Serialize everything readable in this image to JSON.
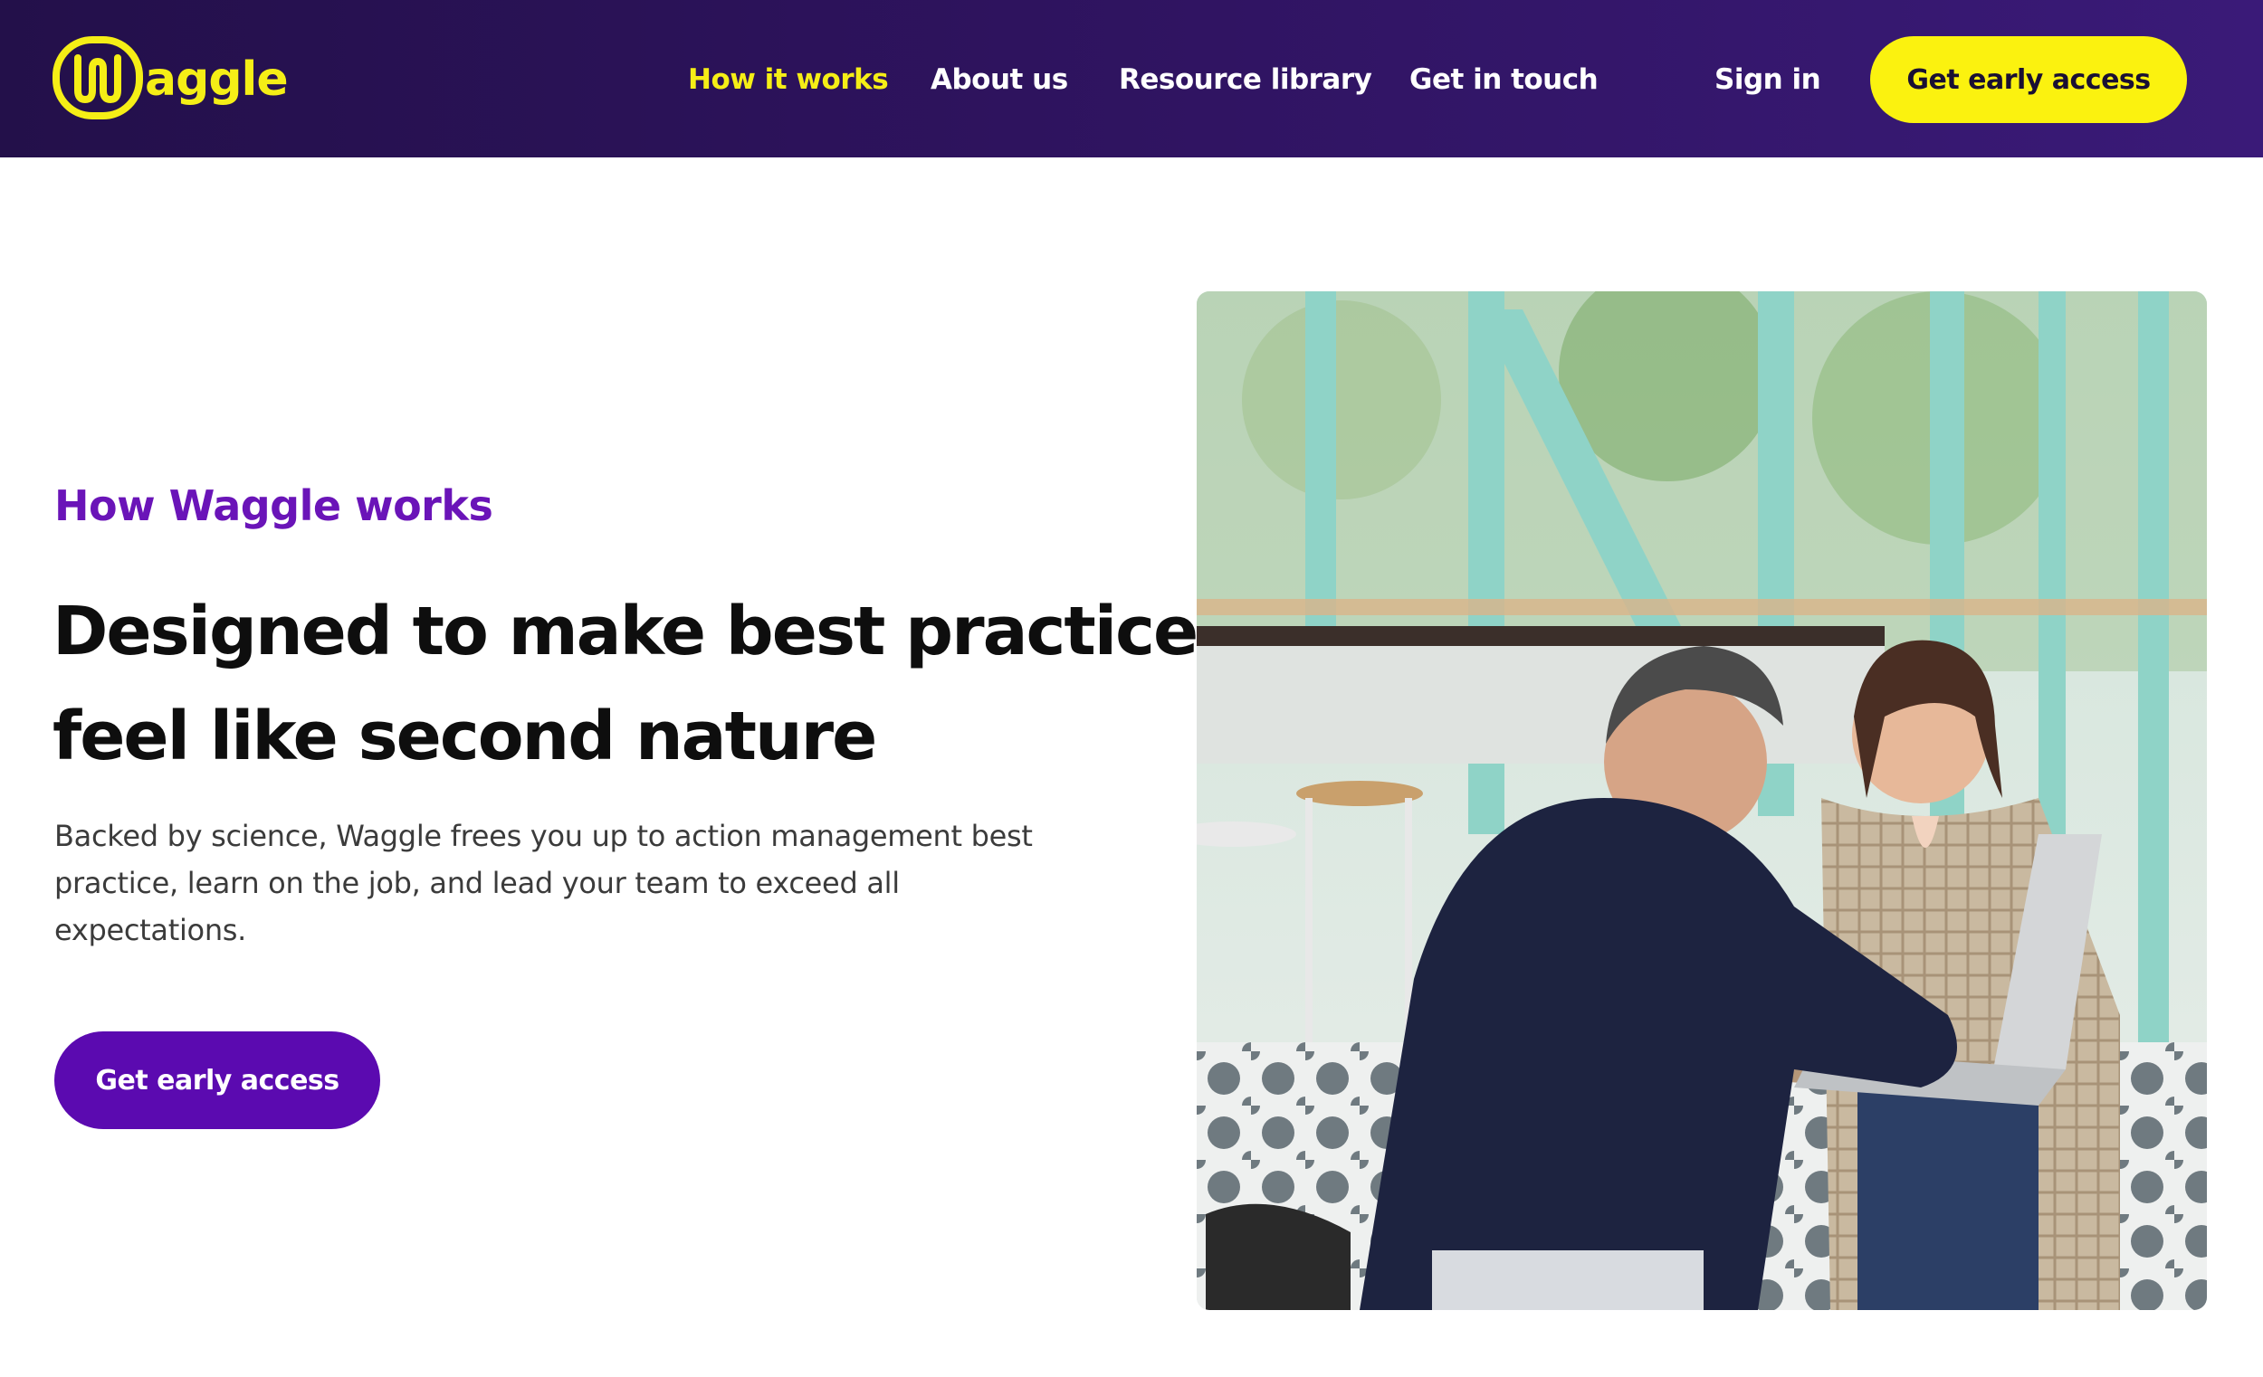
{
  "brand": {
    "name": "Waggle",
    "logo_letter": "W",
    "logo_rest": "aggle",
    "colors": {
      "header_bg": "#2e135e",
      "accent_yellow": "#f5ee16",
      "accent_purple": "#5b0ab0",
      "eyebrow_purple": "#6a14b8"
    }
  },
  "header": {
    "nav": [
      {
        "label": "How it works",
        "active": true
      },
      {
        "label": "About us",
        "active": false
      },
      {
        "label": "Resource library",
        "active": false
      },
      {
        "label": "Get in touch",
        "active": false
      }
    ],
    "sign_in_label": "Sign in",
    "cta_label": "Get early access"
  },
  "hero": {
    "eyebrow": "How Waggle works",
    "headline_line1": "Designed to make best practice",
    "headline_line2": "feel like second nature",
    "description": "Backed by science, Waggle frees you up to action management best practice, learn on the job, and lead your team to exceed all expectations.",
    "cta_label": "Get early access",
    "image_icon": "photo-two-people-laptop-cafe"
  }
}
